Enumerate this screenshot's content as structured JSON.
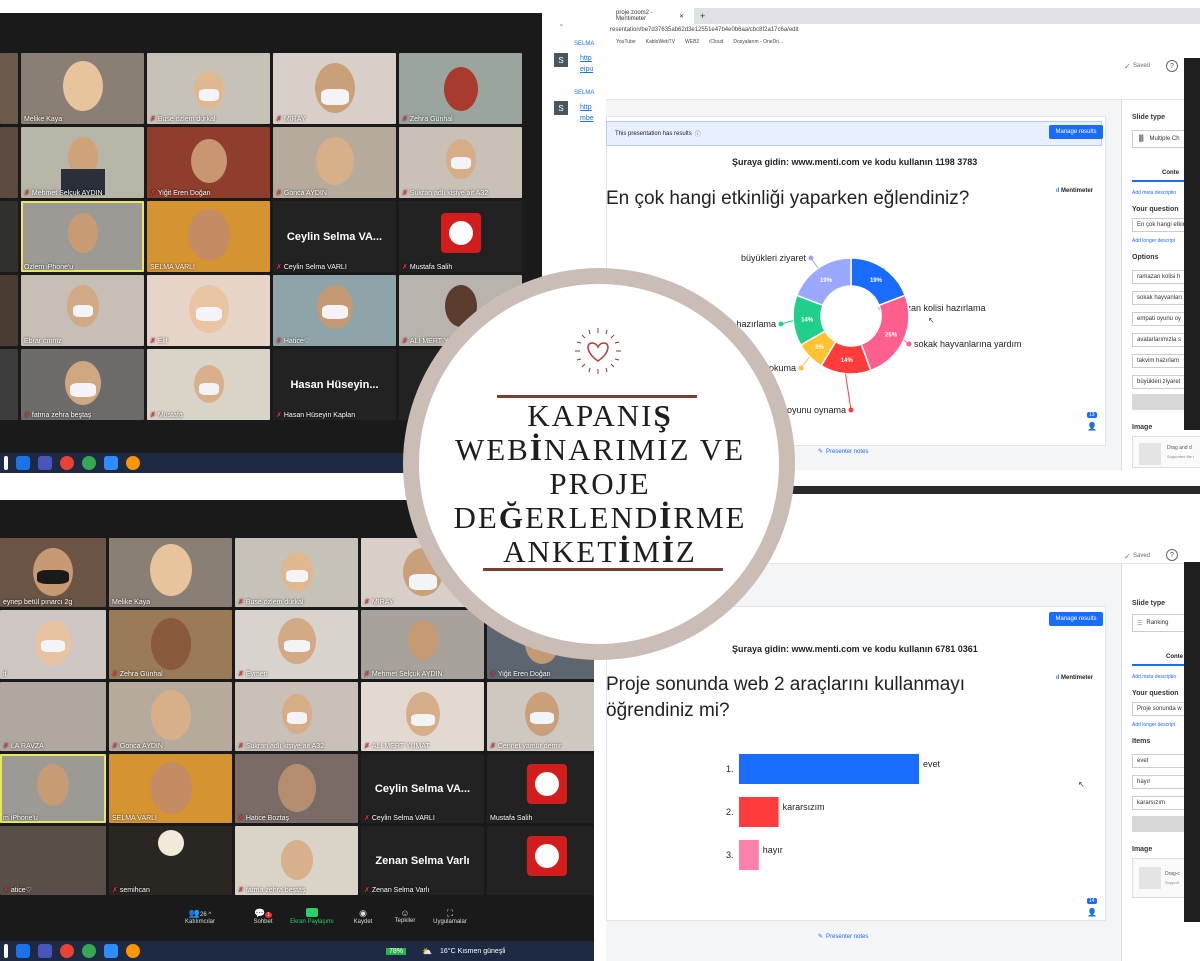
{
  "title": {
    "line1_a": "KAPANI",
    "line1_b": "Ş",
    "line2_a": "WEB",
    "line2_b": "İ",
    "line2_c": "NARIMIZ VE",
    "line3": "PROJE",
    "line4_a": "DE",
    "line4_b": "Ğ",
    "line4_c": "ERLEND",
    "line4_d": "İ",
    "line4_e": "RME",
    "line5_a": "ANKET",
    "line5_b": "İ",
    "line5_c": "M",
    "line5_d": "İ",
    "line5_e": "Z"
  },
  "colors": {
    "accent_red": "#7a3e35",
    "menti_blue": "#196cff",
    "circle_ring": "#c9bdb6"
  },
  "zoom_top": {
    "chat": {
      "sender1": "SELMA",
      "link1": "http",
      "link1b": "eipu",
      "sender2": "SELMA",
      "link2": "http",
      "link2b": "mbe"
    },
    "rows": [
      [
        "Melike Kaya",
        "Buse özlem durkal",
        "MİRAY",
        "Zehra Günhal"
      ],
      [
        "Mehmet Selçuk AYDIN",
        "Yiğit Eren Doğan",
        "Gonca AYDIN",
        "Sukran adlı kişiye ait A32"
      ],
      [
        "Özlem iPhone'u",
        "SELMA VARLI",
        "Ceylin Selma VARLI",
        "Mustafa Salih"
      ],
      [
        "Ebrar cmmz",
        "Elif",
        "Hatice♡",
        "ALİ MERT YUM"
      ],
      [
        "fatma zehra beştaş",
        "Mustafa",
        "Hasan Hüseyin Kaplan",
        ""
      ]
    ],
    "big_names": {
      "ceylin": "Ceylin Selma VA...",
      "hasan": "Hasan Hüseyin...",
      "ri": "Ri"
    }
  },
  "zoom_bottom": {
    "rows": [
      [
        "eynep betül pınarcı 2g",
        "Melike Kaya",
        "Buse özlem durkal",
        "MİRAY"
      ],
      [
        "if",
        "Zehra Günhal",
        "Eymen",
        "Mehmet Selçuk AYDIN",
        "Yiğit Eren Doğan"
      ],
      [
        "LA RAVZA",
        "Gonca AYDIN",
        "Sukran adlı kişiye ait A32",
        "ALİ MERT YUMAT",
        "Cennet yamur demir"
      ],
      [
        "m iPhone'u",
        "SELMA VARLI",
        "Hatice Boztaş",
        "Ceylin Selma VARLI",
        "Mustafa Salih"
      ],
      [
        "atice♡",
        "semihcan",
        "fatma zehra beştaş",
        "Zenan Selma Varlı"
      ]
    ],
    "big_names": {
      "ceylin": "Ceylin Selma VA...",
      "zenan": "Zenan Selma Varlı"
    },
    "controls": {
      "participants_label": "Katılımcılar",
      "participants_count": "26",
      "chat_label": "Sohbet",
      "chat_badge": "1",
      "share_label": "Ekran Paylaşımı",
      "record_label": "Kaydet",
      "reactions_label": "Tepkiler",
      "apps_label": "Uygulamalar"
    },
    "taskbar": {
      "battery": "78%",
      "weather": "16°C  Kısmen güneşli"
    }
  },
  "menti_top": {
    "tab_title": "proje zoom2 - Mentimeter",
    "url": "resentation/be7d37635ab62d3e12551e47b4e0b6aa/cbc8f2a17c6a/edit",
    "bookmarks": [
      "YouTube",
      "KabloWebTV",
      "WEB2",
      "iCloud",
      "Dosyalarım - OneDri..."
    ],
    "saved": "Saved",
    "banner": "This presentation has results",
    "manage": "Manage results",
    "join": "Şuraya gidin: www.menti.com ve kodu kullanın 1198 3783",
    "question": "En çok hangi etkinliği yaparken eğlendiniz?",
    "logo": "Mentimeter",
    "presenter_notes": "Presenter notes",
    "vote_count": "13",
    "side": {
      "slide_type_label": "Slide type",
      "slide_type": "Multiple Ch",
      "tab": "Conte",
      "meta": "Add meta descriptio",
      "your_question": "Your question",
      "question_value": "En çok hangi etkin",
      "longer": "Add longer descript",
      "options_label": "Options",
      "options": [
        "ramazan kolisi h",
        "sokak hayvanları",
        "empati oyunu oy",
        "avatarlarımızla s",
        "takvim hazırlam",
        "büyükleri ziyaret"
      ],
      "image_label": "Image",
      "drag": "Drag and d",
      "supported": "Supported file t"
    }
  },
  "menti_bottom": {
    "saved": "Saved",
    "manage": "Manage results",
    "join": "Şuraya gidin: www.menti.com ve kodu kullanın 6781 0361",
    "question_l1": "Proje sonunda web 2 araçlarını kullanmayı",
    "question_l2": "öğrendiniz mi?",
    "logo": "Mentimeter",
    "presenter_notes": "Presenter notes",
    "vote_count": "14",
    "side": {
      "slide_type_label": "Slide type",
      "slide_type": "Ranking",
      "tab": "Conte",
      "meta": "Add meta descriptio",
      "your_question": "Your question",
      "question_value": "Proje sonunda w",
      "longer": "Add longer descript",
      "items_label": "Items",
      "items": [
        "evet",
        "hayır",
        "kararsızım"
      ],
      "image_label": "Image",
      "drag": "Drag-c",
      "supported": "Support"
    }
  },
  "chart_data": [
    {
      "type": "pie",
      "categories": [
        "ramazan kolisi hazırlama",
        "sokak hayvanlarına yardım",
        "oyunu oynama",
        "okuma",
        "hazırlama",
        "büyükleri ziyaret"
      ],
      "values": [
        19,
        25,
        14,
        8,
        14,
        19
      ],
      "labels": [
        "19%",
        "25%",
        "14%",
        "8%",
        "14%",
        "19%"
      ],
      "colors": [
        "#196cff",
        "#ff5f8f",
        "#ff3b3b",
        "#ffc233",
        "#1fcf8a",
        "#9ba8ff"
      ]
    },
    {
      "type": "bar",
      "categories": [
        "evet",
        "kararsızım",
        "hayır"
      ],
      "ranks": [
        "1.",
        "2.",
        "3."
      ],
      "values": [
        100,
        22,
        11
      ],
      "colors": [
        "#196cff",
        "#ff3b3b",
        "#ff7fab"
      ]
    }
  ]
}
